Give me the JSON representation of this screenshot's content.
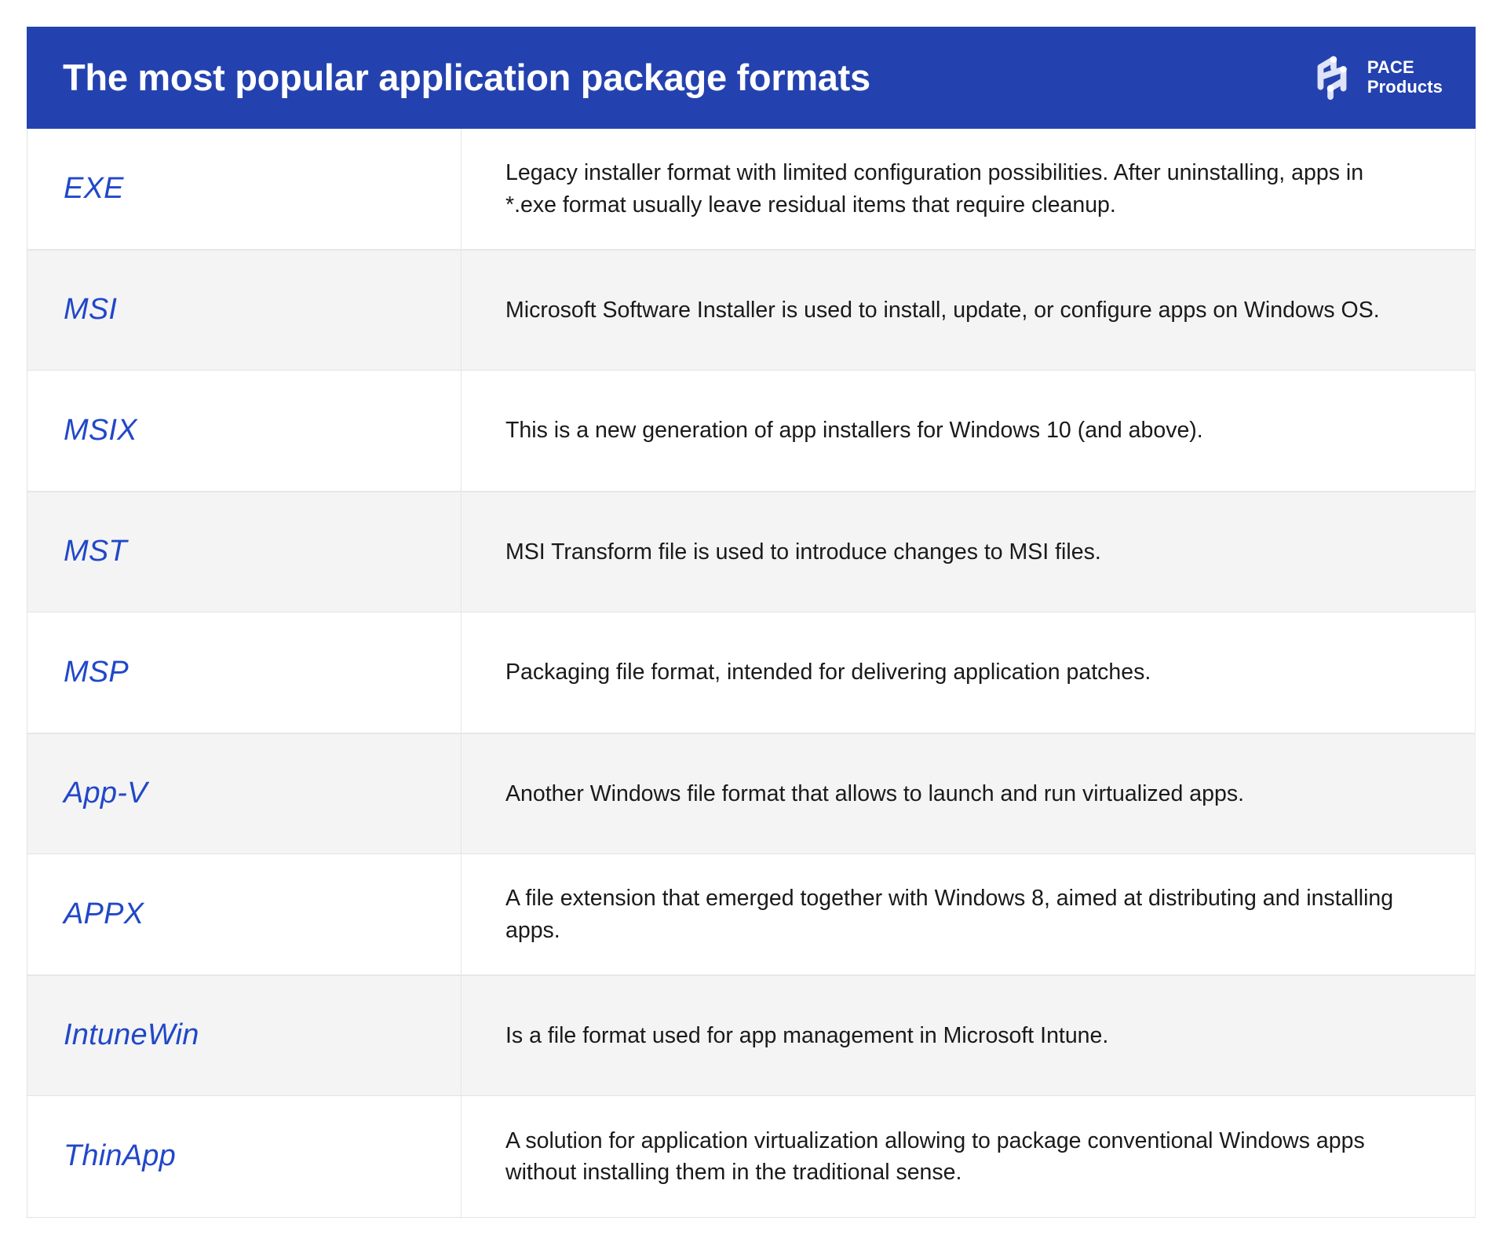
{
  "header": {
    "title": "The most popular application package formats",
    "brand": {
      "logo_icon": "pace-logo-mark",
      "line1": "PACE",
      "line2": "Products"
    },
    "background_color": "#2442AF"
  },
  "table": {
    "accent_color": "#2148C8",
    "stripe_color": "#f4f4f4",
    "rows": [
      {
        "format": "EXE",
        "description": "Legacy installer format with limited configuration possibilities. After uninstalling, apps in *.exe format usually leave residual items that require cleanup."
      },
      {
        "format": "MSI",
        "description": "Microsoft Software Installer is used to install, update, or configure apps on Windows OS."
      },
      {
        "format": "MSIX",
        "description": "This is a new generation of app installers for Windows 10 (and above)."
      },
      {
        "format": "MST",
        "description": "MSI Transform file is used to introduce changes to MSI files."
      },
      {
        "format": "MSP",
        "description": "Packaging file format, intended for delivering application patches."
      },
      {
        "format": "App-V",
        "description": "Another Windows file format that allows to launch and run virtualized apps."
      },
      {
        "format": "APPX",
        "description": "A file extension that emerged together with Windows 8, aimed at distributing and installing apps."
      },
      {
        "format": "IntuneWin",
        "description": "Is a file format used for app management in Microsoft Intune."
      },
      {
        "format": "ThinApp",
        "description": "A solution for application virtualization allowing to package conventional Windows apps without installing them in the traditional sense."
      }
    ]
  }
}
